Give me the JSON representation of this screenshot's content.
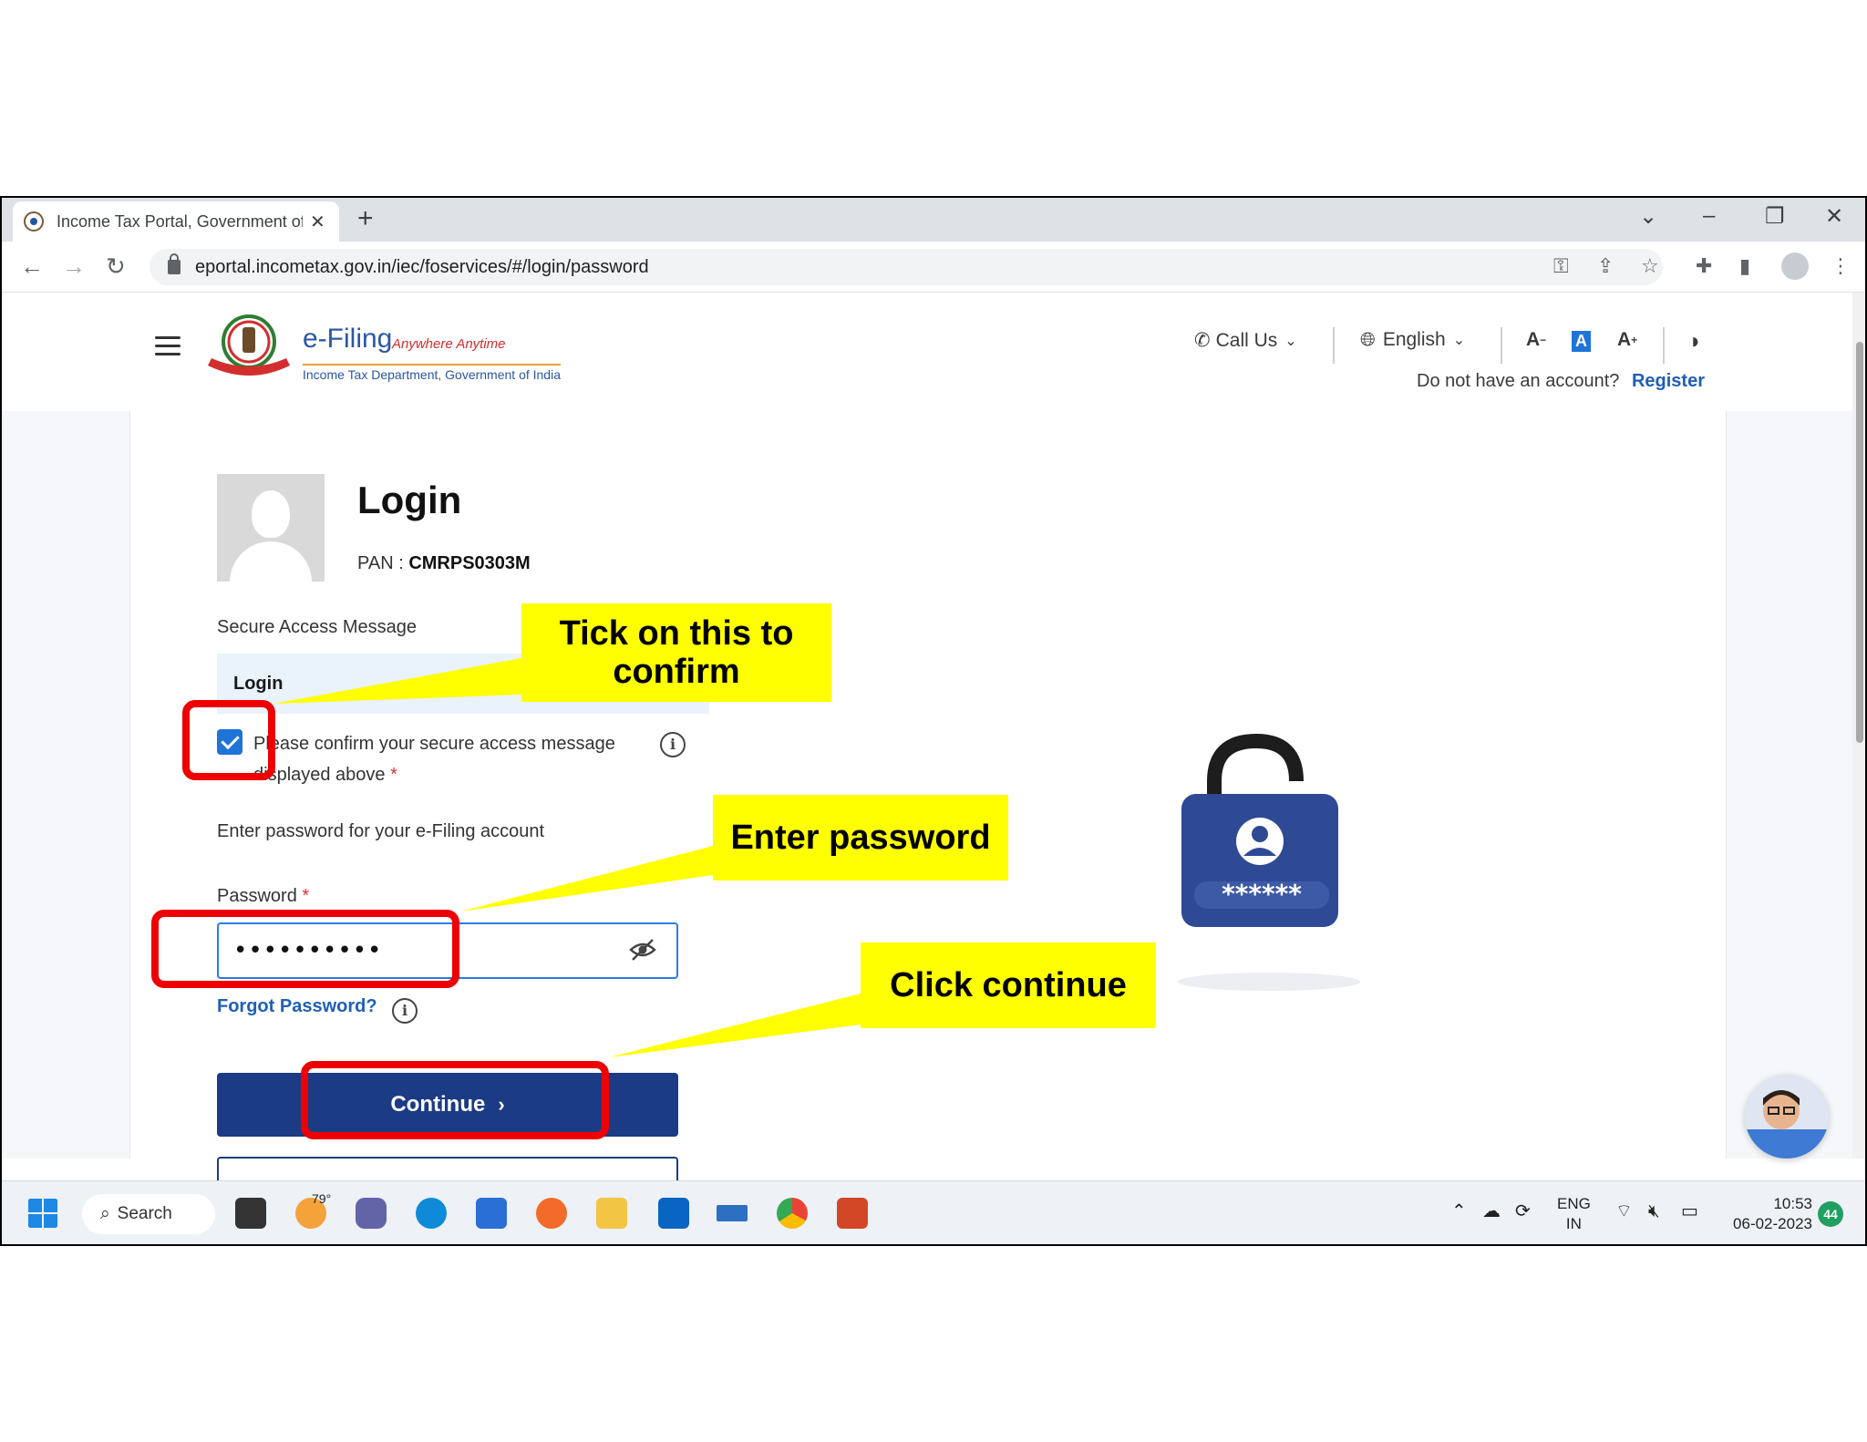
{
  "browser": {
    "tab_title": "Income Tax Portal, Government of India",
    "new_tab": "+",
    "url": "eportal.incometax.gov.in/iec/foservices/#/login/password"
  },
  "header": {
    "logo_title": "e-Filing",
    "logo_tagline": "Anywhere Anytime",
    "logo_subtitle": "Income Tax Department, Government of India",
    "call_us": "Call Us",
    "language": "English",
    "font_decrease": "A",
    "font_default": "A",
    "font_increase": "A",
    "no_account_text": "Do not have an account?",
    "register_link": "Register"
  },
  "login": {
    "title": "Login",
    "pan_label": "PAN :",
    "pan_value": "CMRPS0303M",
    "secure_message_label": "Secure Access Message",
    "secure_message_value": "Login",
    "confirm_text": "Please confirm your secure access message displayed above",
    "required_mark": "*",
    "password_hint": "Enter password for your e-Filing account",
    "password_label": "Password",
    "password_value": "••••••••••",
    "forgot_password": "Forgot Password?",
    "continue_button": "Continue",
    "lock_stars": "******"
  },
  "annotations": {
    "tick_callout": "Tick on this to confirm",
    "password_callout": "Enter password",
    "continue_callout": "Click continue",
    "color": "#ffff00",
    "highlight_color": "#ee0000"
  },
  "taskbar": {
    "search_label": "Search",
    "weather": "79°",
    "lang_top": "ENG",
    "lang_bottom": "IN",
    "time": "10:53",
    "date": "06-02-2023",
    "notification_count": "44"
  }
}
